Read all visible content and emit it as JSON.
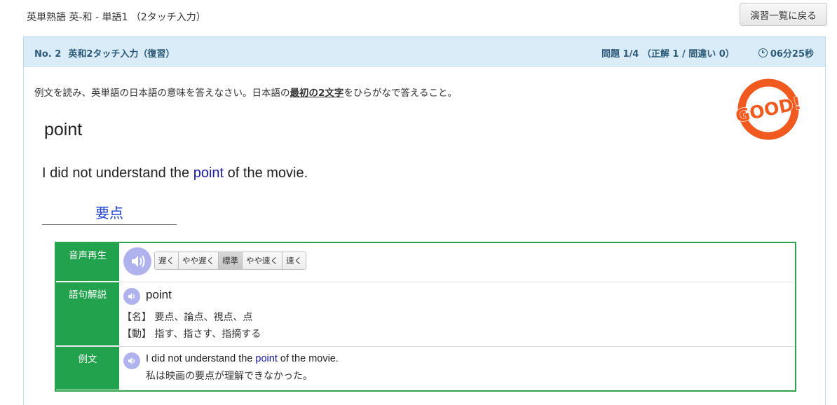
{
  "header": {
    "breadcrumb": "英単熟語 英-和 - 単語1 （2タッチ入力）",
    "back_button": "演習一覧に戻る"
  },
  "panel": {
    "number": "No. 2",
    "mode": "英和2タッチ入力（復習）",
    "score": "問題 1/4 （正解 1 / 間違い 0）",
    "timer": "06分25秒"
  },
  "question": {
    "instruction_pre": "例文を読み、英単語の日本語の意味を答えなさい。日本語の",
    "instruction_em": "最初の2文字",
    "instruction_post": "をひらがなで答えること。",
    "word": "point",
    "sentence_pre": "I did not understand the ",
    "sentence_word": "point",
    "sentence_post": " of the movie.",
    "answer": "要点",
    "stamp_text": "GOOD!"
  },
  "info": {
    "audio_label": "音声再生",
    "speeds": [
      "遅く",
      "やや遅く",
      "標準",
      "やや速く",
      "速く"
    ],
    "selected_speed": "標準",
    "phrase_label": "語句解説",
    "phrase_word": "point",
    "definitions": [
      "【名】 要点、論点、視点、点",
      "【動】 指す、指さす、指摘する"
    ],
    "example_label": "例文",
    "example_en_pre": "I did not understand the ",
    "example_en_word": "point",
    "example_en_post": " of the movie.",
    "example_ja": "私は映画の要点が理解できなかった。"
  },
  "colors": {
    "panel_header_bg": "#d9ecf7",
    "panel_header_text": "#2d5a78",
    "label_green": "#23a24d",
    "highlight_blue": "#1a1aa6",
    "answer_blue": "#1a3fd0",
    "stamp_orange": "#f05a1e",
    "speaker_purple": "#b0b2ee"
  }
}
